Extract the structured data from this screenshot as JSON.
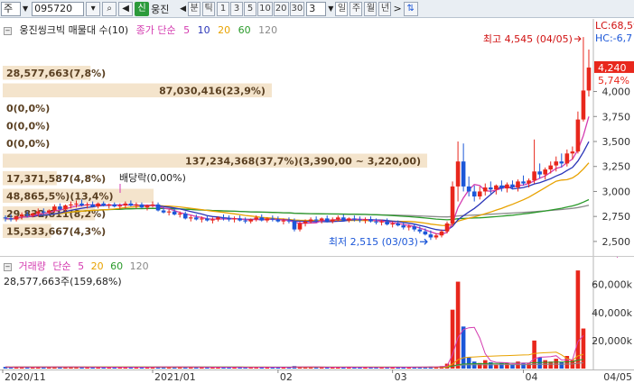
{
  "toolbar": {
    "market": "주",
    "code": "095720",
    "badge": "신",
    "name": "웅진",
    "period_label": "분",
    "tick_label": "틱",
    "intervals": [
      "1",
      "3",
      "5",
      "10",
      "20",
      "30"
    ],
    "interval_value": "3",
    "day": "일",
    "week": "주",
    "month": "월",
    "year": "년"
  },
  "price_header": {
    "title": "웅진씽크빅 매물대 수(10)",
    "ma_label": "종가 단순",
    "ma_periods": [
      "5",
      "10",
      "20",
      "60",
      "120"
    ]
  },
  "volume_header": {
    "title": "거래량",
    "ma_label": "단순",
    "ma_periods": [
      "5",
      "20",
      "60",
      "120"
    ],
    "value_text": "28,577,663주(159,68%)"
  },
  "price_axis": {
    "ticks": [
      "4,000",
      "3,750",
      "3,500",
      "3,250",
      "3,000",
      "2,750",
      "2,500"
    ],
    "lc_label": "LC:68,59",
    "hc_label": "HC:-6,7",
    "last_price": "4,240",
    "last_change": "5,74%"
  },
  "volume_axis": {
    "ticks": [
      "60,000k",
      "40,000k",
      "20,000k"
    ],
    "last_volume": "28,578",
    "last_ratio": "159,68"
  },
  "x_axis": {
    "labels": [
      "2020/11",
      "2021/01",
      "02",
      "03",
      "04",
      "04/05"
    ]
  },
  "annotations": {
    "high": "최고 4,545 (04/05)",
    "low": "최저 2,515 (03/03)",
    "dividend": "배당락(0,00%)"
  },
  "volume_profile": [
    {
      "text": "28,577,663(7,8%)",
      "fraction": 0.078
    },
    {
      "text": "87,030,416(23,9%)",
      "fraction": 0.239
    },
    {
      "text": "0(0,0%)",
      "fraction": 0.0
    },
    {
      "text": "0(0,0%)",
      "fraction": 0.0
    },
    {
      "text": "0(0,0%)",
      "fraction": 0.0
    },
    {
      "text": "137,234,368(37,7%)(3,390,00 ~ 3,220,00)",
      "fraction": 0.377
    },
    {
      "text": "17,371,587(4,8%)",
      "fraction": 0.048
    },
    {
      "text": "48,865,5%)(13,4%)",
      "fraction": 0.134
    },
    {
      "text": "29,832,811(8,2%)",
      "fraction": 0.082
    },
    {
      "text": "15,533,667(4,3%)",
      "fraction": 0.043
    }
  ],
  "chart_data": {
    "type": "candlestick",
    "ylim": [
      2400,
      4600
    ],
    "volume_ylim": [
      0,
      72000
    ],
    "volume_units": "k shares",
    "start_label": "2020/11",
    "end_label": "04/05",
    "candles": [
      [
        2740,
        2760,
        2700,
        2730
      ],
      [
        2730,
        2770,
        2700,
        2720
      ],
      [
        2720,
        2760,
        2700,
        2750
      ],
      [
        2750,
        2790,
        2720,
        2770
      ],
      [
        2770,
        2800,
        2740,
        2760
      ],
      [
        2760,
        2790,
        2740,
        2780
      ],
      [
        2780,
        2830,
        2750,
        2800
      ],
      [
        2800,
        2830,
        2770,
        2790
      ],
      [
        2790,
        2820,
        2770,
        2810
      ],
      [
        2810,
        2870,
        2790,
        2850
      ],
      [
        2850,
        2880,
        2810,
        2820
      ],
      [
        2820,
        2870,
        2800,
        2860
      ],
      [
        2860,
        2900,
        2830,
        2870
      ],
      [
        2870,
        2910,
        2840,
        2880
      ],
      [
        2880,
        2920,
        2850,
        2860
      ],
      [
        2860,
        2890,
        2830,
        2870
      ],
      [
        2870,
        2900,
        2840,
        2850
      ],
      [
        2850,
        2890,
        2830,
        2880
      ],
      [
        2880,
        2900,
        2850,
        2860
      ],
      [
        2860,
        2880,
        2830,
        2870
      ],
      [
        2870,
        2890,
        2840,
        2850
      ],
      [
        2850,
        2880,
        2820,
        2860
      ],
      [
        2860,
        2900,
        2830,
        2880
      ],
      [
        2880,
        2910,
        2850,
        2860
      ],
      [
        2860,
        2890,
        2830,
        2870
      ],
      [
        2870,
        2890,
        2830,
        2840
      ],
      [
        2840,
        2870,
        2810,
        2860
      ],
      [
        2860,
        2900,
        2840,
        2870
      ],
      [
        2870,
        2890,
        2800,
        2810
      ],
      [
        2810,
        2840,
        2780,
        2790
      ],
      [
        2790,
        2820,
        2760,
        2800
      ],
      [
        2800,
        2830,
        2760,
        2770
      ],
      [
        2770,
        2800,
        2740,
        2780
      ],
      [
        2780,
        2800,
        2720,
        2730
      ],
      [
        2730,
        2760,
        2700,
        2740
      ],
      [
        2740,
        2770,
        2710,
        2720
      ],
      [
        2720,
        2750,
        2690,
        2730
      ],
      [
        2730,
        2760,
        2700,
        2710
      ],
      [
        2710,
        2740,
        2680,
        2720
      ],
      [
        2720,
        2750,
        2700,
        2740
      ],
      [
        2740,
        2770,
        2710,
        2730
      ],
      [
        2730,
        2760,
        2700,
        2720
      ],
      [
        2720,
        2750,
        2690,
        2730
      ],
      [
        2730,
        2760,
        2700,
        2710
      ],
      [
        2710,
        2740,
        2680,
        2700
      ],
      [
        2700,
        2730,
        2680,
        2720
      ],
      [
        2720,
        2760,
        2700,
        2740
      ],
      [
        2740,
        2770,
        2700,
        2710
      ],
      [
        2710,
        2740,
        2690,
        2730
      ],
      [
        2730,
        2760,
        2700,
        2720
      ],
      [
        2720,
        2750,
        2690,
        2700
      ],
      [
        2700,
        2730,
        2670,
        2710
      ],
      [
        2710,
        2740,
        2680,
        2700
      ],
      [
        2700,
        2730,
        2600,
        2620
      ],
      [
        2620,
        2700,
        2600,
        2680
      ],
      [
        2680,
        2720,
        2650,
        2700
      ],
      [
        2700,
        2740,
        2680,
        2720
      ],
      [
        2720,
        2750,
        2690,
        2710
      ],
      [
        2710,
        2740,
        2680,
        2730
      ],
      [
        2730,
        2760,
        2690,
        2700
      ],
      [
        2700,
        2740,
        2680,
        2720
      ],
      [
        2720,
        2760,
        2700,
        2740
      ],
      [
        2740,
        2770,
        2700,
        2710
      ],
      [
        2710,
        2740,
        2690,
        2730
      ],
      [
        2730,
        2760,
        2700,
        2720
      ],
      [
        2720,
        2750,
        2690,
        2710
      ],
      [
        2710,
        2740,
        2680,
        2720
      ],
      [
        2720,
        2750,
        2690,
        2700
      ],
      [
        2700,
        2730,
        2670,
        2690
      ],
      [
        2690,
        2720,
        2660,
        2700
      ],
      [
        2700,
        2730,
        2660,
        2670
      ],
      [
        2670,
        2700,
        2640,
        2680
      ],
      [
        2680,
        2710,
        2650,
        2660
      ],
      [
        2660,
        2690,
        2620,
        2640
      ],
      [
        2640,
        2670,
        2610,
        2650
      ],
      [
        2650,
        2680,
        2600,
        2620
      ],
      [
        2620,
        2650,
        2580,
        2600
      ],
      [
        2600,
        2630,
        2560,
        2570
      ],
      [
        2570,
        2610,
        2515,
        2540
      ],
      [
        2540,
        2580,
        2520,
        2560
      ],
      [
        2560,
        2620,
        2540,
        2600
      ],
      [
        2600,
        2700,
        2580,
        2680
      ],
      [
        2680,
        3100,
        2650,
        3050
      ],
      [
        3050,
        3500,
        2900,
        3300
      ],
      [
        3300,
        3480,
        3000,
        3050
      ],
      [
        3050,
        3150,
        2950,
        3000
      ],
      [
        3000,
        3060,
        2900,
        2950
      ],
      [
        2950,
        3050,
        2920,
        3000
      ],
      [
        3000,
        3080,
        2960,
        3040
      ],
      [
        3040,
        3100,
        2980,
        3020
      ],
      [
        3020,
        3070,
        2970,
        3060
      ],
      [
        3060,
        3110,
        3000,
        3030
      ],
      [
        3030,
        3090,
        2990,
        3070
      ],
      [
        3070,
        3110,
        3020,
        3040
      ],
      [
        3040,
        3120,
        3000,
        3100
      ],
      [
        3100,
        3160,
        3060,
        3080
      ],
      [
        3080,
        3130,
        3040,
        3110
      ],
      [
        3110,
        3520,
        3080,
        3200
      ],
      [
        3200,
        3280,
        3130,
        3170
      ],
      [
        3170,
        3240,
        3120,
        3220
      ],
      [
        3220,
        3300,
        3180,
        3260
      ],
      [
        3260,
        3350,
        3200,
        3300
      ],
      [
        3300,
        3380,
        3240,
        3280
      ],
      [
        3280,
        3420,
        3250,
        3380
      ],
      [
        3380,
        3450,
        3320,
        3400
      ],
      [
        3400,
        3800,
        3380,
        3720
      ],
      [
        3720,
        4545,
        3700,
        4010
      ],
      [
        4010,
        4420,
        3950,
        4240
      ]
    ],
    "volume": [
      1200,
      900,
      1100,
      1300,
      1000,
      900,
      1400,
      1100,
      950,
      1600,
      1200,
      1000,
      1300,
      1100,
      900,
      1000,
      950,
      1050,
      900,
      1000,
      950,
      900,
      1000,
      950,
      900,
      1100,
      1000,
      1050,
      1500,
      1300,
      1200,
      1100,
      1000,
      1250,
      1100,
      950,
      1000,
      900,
      950,
      1000,
      900,
      950,
      1000,
      900,
      850,
      900,
      1000,
      1100,
      950,
      900,
      900,
      850,
      900,
      1800,
      1400,
      1100,
      1000,
      950,
      900,
      1000,
      950,
      1000,
      1100,
      950,
      900,
      900,
      850,
      900,
      950,
      900,
      1000,
      950,
      900,
      1100,
      1000,
      1050,
      1200,
      1100,
      1500,
      1300,
      1800,
      3500,
      42000,
      62000,
      30000,
      8000,
      5000,
      4000,
      6000,
      4500,
      3000,
      4000,
      3500,
      3000,
      5000,
      4000,
      3500,
      20000,
      8000,
      6000,
      5000,
      7000,
      4500,
      9000,
      6000,
      70000,
      28578
    ],
    "moving_averages": [
      {
        "period": 5,
        "color": "#d43cb0"
      },
      {
        "period": 10,
        "color": "#2a35b8"
      },
      {
        "period": 20,
        "color": "#e8a200"
      },
      {
        "period": 60,
        "color": "#2a9a2a"
      },
      {
        "period": 120,
        "color": "#8a8a8a"
      }
    ],
    "volume_moving_averages": [
      {
        "period": 5,
        "color": "#d43cb0"
      },
      {
        "period": 20,
        "color": "#e8a200"
      },
      {
        "period": 60,
        "color": "#2a9a2a"
      },
      {
        "period": 120,
        "color": "#8a8a8a"
      }
    ],
    "up_color": "#e8271c",
    "down_color": "#1c57d8"
  }
}
